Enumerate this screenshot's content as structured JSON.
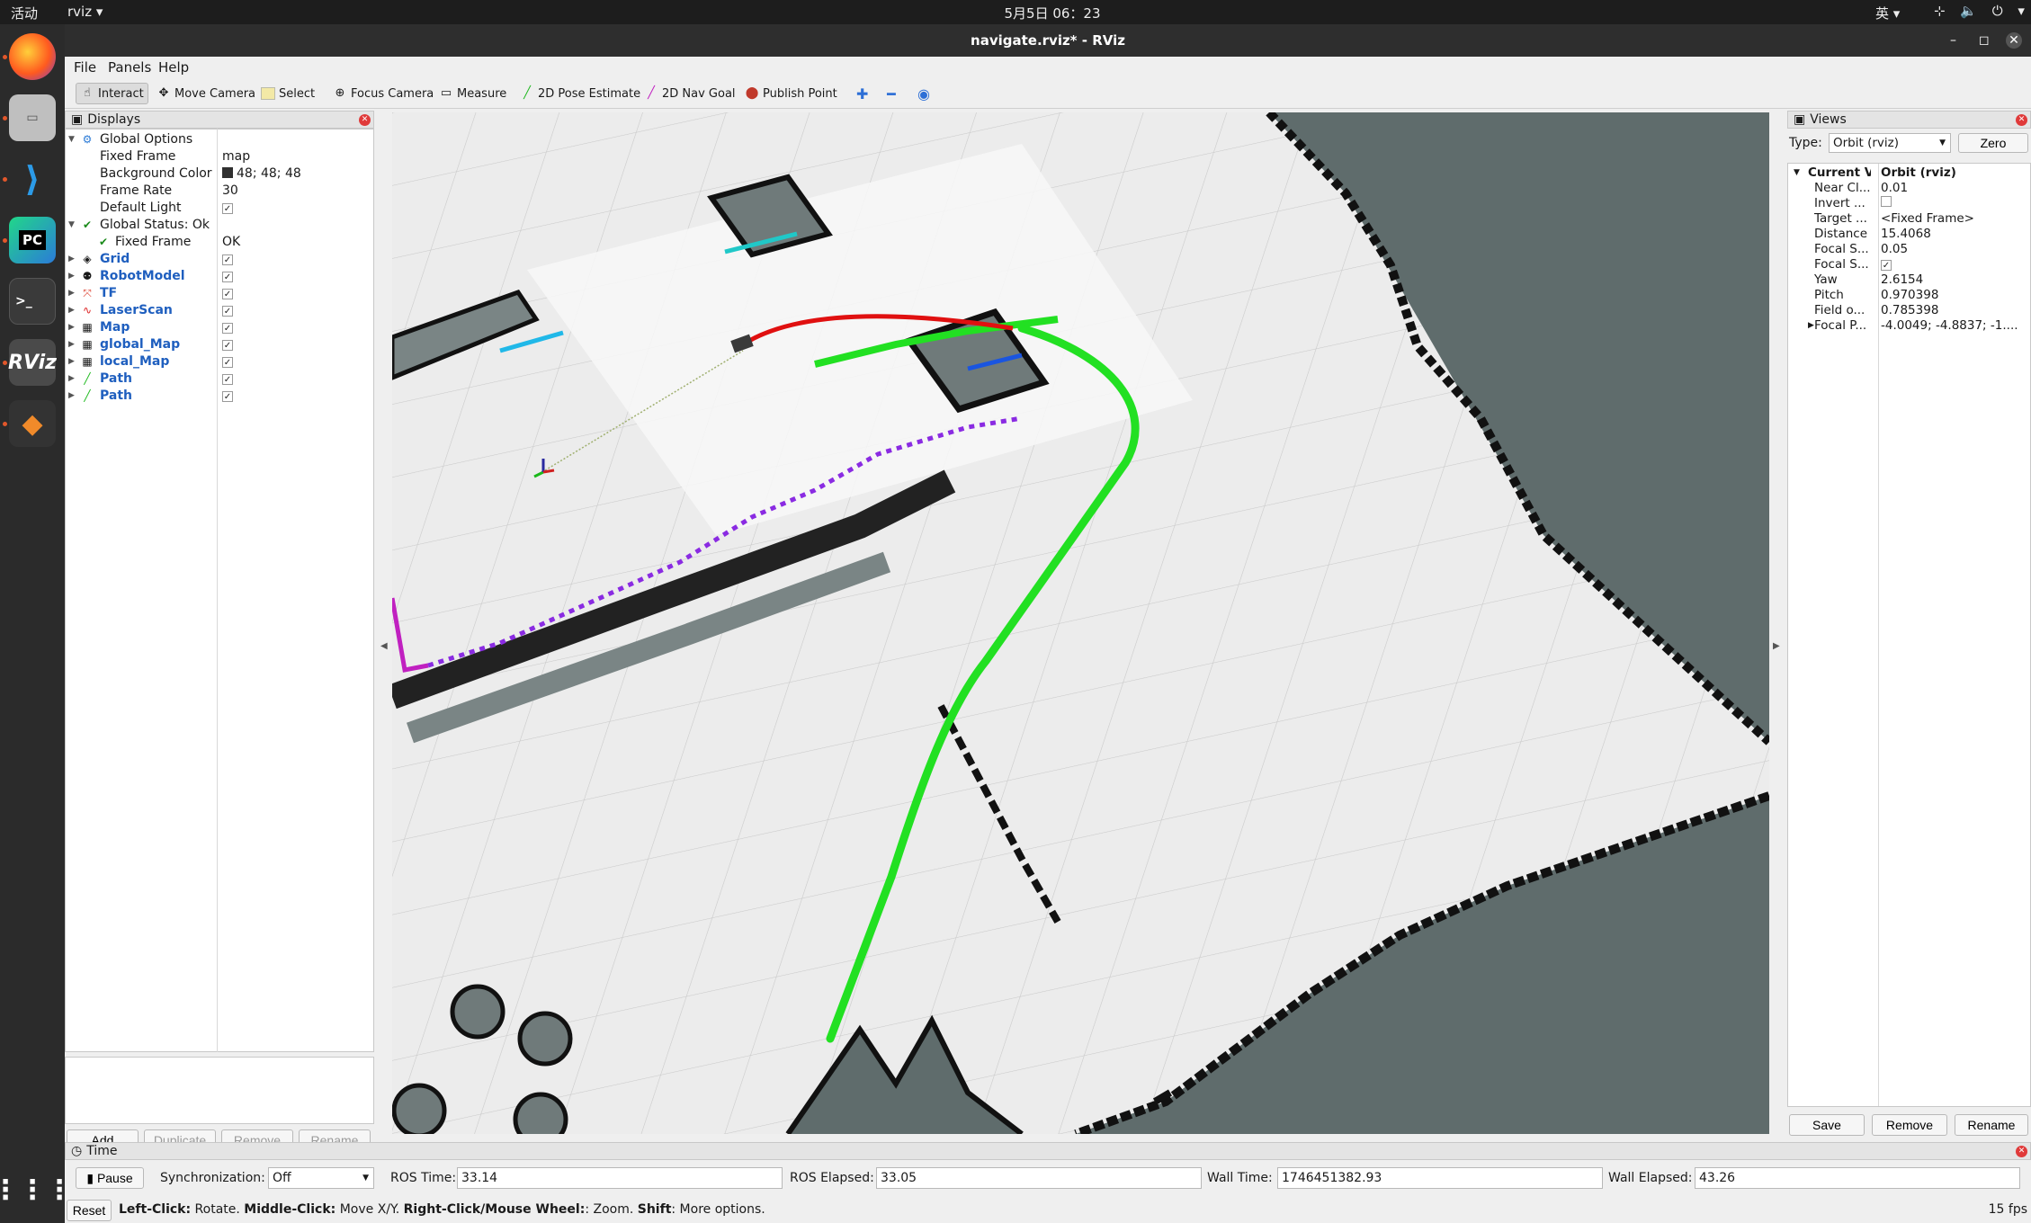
{
  "topbar": {
    "activities": "活动",
    "app": "rviz ▾",
    "clock": "5月5日  06：23",
    "ime": "英 ▾",
    "tray": "⊹ 🔈 ⏻ ▾"
  },
  "dock": {
    "items": [
      "firefox-icon",
      "files-icon",
      "vscode-icon",
      "pycharm-icon",
      "terminal-icon",
      "rviz-icon",
      "stack-icon",
      "apps-grid-icon"
    ]
  },
  "window": {
    "title": "navigate.rviz* - RViz"
  },
  "menu": {
    "file": "File",
    "panels": "Panels",
    "help": "Help"
  },
  "toolbar": {
    "interact": "Interact",
    "move_camera": "Move Camera",
    "select": "Select",
    "focus_camera": "Focus Camera",
    "measure": "Measure",
    "pose_estimate": "2D Pose Estimate",
    "nav_goal": "2D Nav Goal",
    "publish_point": "Publish Point"
  },
  "displays": {
    "header": "Displays",
    "global_options": "Global Options",
    "fixed_frame_label": "Fixed Frame",
    "fixed_frame_value": "map",
    "bg_color_label": "Background Color",
    "bg_color_value": "48; 48; 48",
    "frame_rate_label": "Frame Rate",
    "frame_rate_value": "30",
    "default_light_label": "Default Light",
    "global_status": "Global Status: Ok",
    "status_fixed_frame": "Fixed Frame",
    "status_fixed_frame_value": "OK",
    "items": [
      "Grid",
      "RobotModel",
      "TF",
      "LaserScan",
      "Map",
      "global_Map",
      "local_Map",
      "Path",
      "Path"
    ],
    "add": "Add",
    "duplicate": "Duplicate",
    "remove": "Remove",
    "rename": "Rename"
  },
  "views": {
    "header": "Views",
    "type_label": "Type:",
    "type_value": "Orbit (rviz)",
    "zero": "Zero",
    "current_view": "Current V...",
    "current_view_value": "Orbit (rviz)",
    "props": [
      {
        "k": "Near Cl...",
        "v": "0.01"
      },
      {
        "k": "Invert ...",
        "v": ""
      },
      {
        "k": "Target ...",
        "v": "<Fixed Frame>"
      },
      {
        "k": "Distance",
        "v": "15.4068"
      },
      {
        "k": "Focal S...",
        "v": "0.05"
      },
      {
        "k": "Focal S...",
        "v": "✓"
      },
      {
        "k": "Yaw",
        "v": "2.6154"
      },
      {
        "k": "Pitch",
        "v": "0.970398"
      },
      {
        "k": "Field o...",
        "v": "0.785398"
      },
      {
        "k": "Focal P...",
        "v": "-4.0049; -4.8837; -1...."
      }
    ],
    "save": "Save",
    "remove": "Remove",
    "rename": "Rename"
  },
  "time": {
    "header": "Time",
    "pause": "Pause",
    "sync_label": "Synchronization:",
    "sync_value": "Off",
    "ros_time_label": "ROS Time:",
    "ros_time": "33.14",
    "ros_elapsed_label": "ROS Elapsed:",
    "ros_elapsed": "33.05",
    "wall_time_label": "Wall Time:",
    "wall_time": "1746451382.93",
    "wall_elapsed_label": "Wall Elapsed:",
    "wall_elapsed": "43.26"
  },
  "status": {
    "reset": "Reset",
    "b1": "Left-Click:",
    "t1": " Rotate. ",
    "b2": "Middle-Click:",
    "t2": " Move X/Y. ",
    "b3": "Right-Click/Mouse Wheel:",
    "t3": ": Zoom. ",
    "b4": "Shift",
    "t4": ": More options.",
    "fps": "15 fps"
  },
  "colors": {
    "global_path": "#22e022",
    "local_path": "#e01010",
    "scan": "#8a2be2",
    "map_bg": "#5e6b6b"
  }
}
